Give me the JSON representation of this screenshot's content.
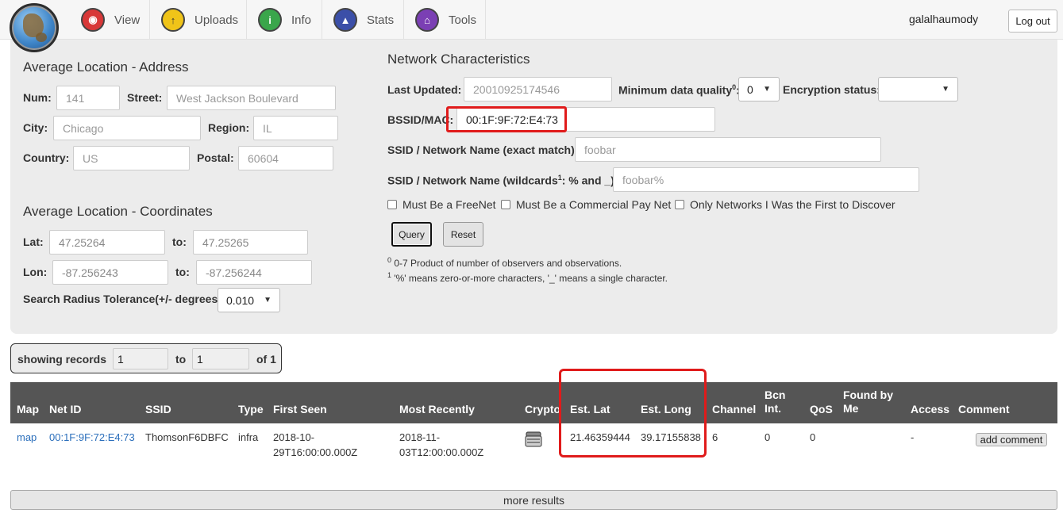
{
  "nav": {
    "logo_icon": "globe-icon",
    "items": [
      {
        "label": "View",
        "icon": "view-icon",
        "color": "#d83838"
      },
      {
        "label": "Uploads",
        "icon": "upload-icon",
        "color": "#f0c419"
      },
      {
        "label": "Info",
        "icon": "info-icon",
        "color": "#3aa64b"
      },
      {
        "label": "Stats",
        "icon": "stats-icon",
        "color": "#3b4fa8"
      },
      {
        "label": "Tools",
        "icon": "tools-icon",
        "color": "#7b3fb4"
      }
    ],
    "username": "galalhaumody",
    "logout_label": "Log out"
  },
  "address": {
    "title": "Average Location - Address",
    "num_label": "Num:",
    "num_placeholder": "141",
    "street_label": "Street:",
    "street_placeholder": "West Jackson Boulevard",
    "city_label": "City:",
    "city_placeholder": "Chicago",
    "region_label": "Region:",
    "region_placeholder": "IL",
    "country_label": "Country:",
    "country_placeholder": "US",
    "postal_label": "Postal:",
    "postal_placeholder": "60604"
  },
  "coords": {
    "title": "Average Location - Coordinates",
    "lat_label": "Lat:",
    "lat_from": "47.25264",
    "to_label": "to:",
    "lat_to": "47.25265",
    "lon_label": "Lon:",
    "lon_from": "-87.256243",
    "lon_to": "-87.256244",
    "radius_label": "Search Radius Tolerance(+/- degrees):",
    "radius_value": "0.010"
  },
  "network": {
    "title": "Network Characteristics",
    "last_updated_label": "Last Updated:",
    "last_updated_placeholder": "20010925174546",
    "min_quality_label": "Minimum data quality",
    "min_quality_sup": "0",
    "min_quality_value": "0",
    "encryption_label": "Encryption status:",
    "encryption_value": "",
    "bssid_label": "BSSID/MAC:",
    "bssid_value": "00:1F:9F:72:E4:73",
    "ssid_exact_label": "SSID / Network Name (exact match):",
    "ssid_exact_placeholder": "foobar",
    "ssid_wild_label_a": "SSID / Network Name (wildcards",
    "ssid_wild_sup": "1",
    "ssid_wild_label_b": ": % and _):",
    "ssid_wild_placeholder": "foobar%",
    "cb_freenet": "Must Be a FreeNet",
    "cb_commercial": "Must Be a Commercial Pay Net",
    "cb_first": "Only Networks I Was the First to Discover",
    "query_label": "Query",
    "reset_label": "Reset",
    "footnote0_sup": "0",
    "footnote0": " 0-7 Product of number of observers and observations.",
    "footnote1_sup": "1",
    "footnote1": " '%' means zero-or-more characters, '_' means a single character."
  },
  "records": {
    "showing_label": "showing records",
    "from": "1",
    "to_label": "to",
    "to": "1",
    "of_label": "of 1"
  },
  "table": {
    "headers": {
      "map": "Map",
      "netid": "Net ID",
      "ssid": "SSID",
      "type": "Type",
      "first_seen": "First Seen",
      "most_recently": "Most Recently",
      "crypto": "Crypto",
      "est_lat": "Est. Lat",
      "est_long": "Est. Long",
      "channel": "Channel",
      "bcn_int": "Bcn Int.",
      "qos": "QoS",
      "found_by_me": "Found by Me",
      "access": "Access",
      "comment": "Comment"
    },
    "row": {
      "map": "map",
      "netid": "00:1F:9F:72:E4:73",
      "ssid": "ThomsonF6DBFC",
      "type": "infra",
      "first_seen": "2018-10-29T16:00:00.000Z",
      "most_recently": "2018-11-03T12:00:00.000Z",
      "crypto_icon": "lock-icon",
      "est_lat": "21.46359444",
      "est_long": "39.17155838",
      "channel": "6",
      "bcn_int": "0",
      "qos": "0",
      "found_by_me": "",
      "access": "-",
      "comment_button": "add comment"
    },
    "more_results": "more results"
  },
  "colors": {
    "highlight": "#e01b1b",
    "header_bg": "#555555",
    "panel_bg": "#ececec",
    "link": "#2a6ebb"
  }
}
